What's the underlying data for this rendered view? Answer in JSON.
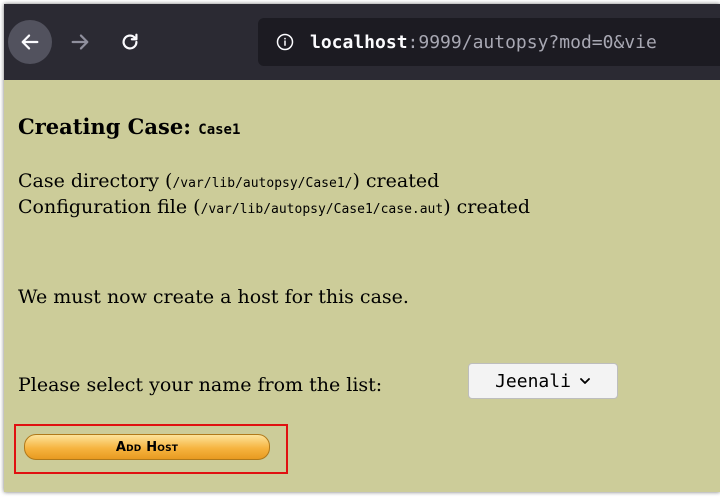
{
  "browser": {
    "url_host": "localhost",
    "url_rest": ":9999/autopsy?mod=0&vie"
  },
  "page": {
    "heading": "Creating Case:",
    "case_name": "Case1",
    "line1_pre": "Case directory (",
    "line1_path": "/var/lib/autopsy/Case1/",
    "line1_post": ") created",
    "line2_pre": "Configuration file (",
    "line2_path": "/var/lib/autopsy/Case1/case.aut",
    "line2_post": ") created",
    "host_message": "We must now create a host for this case.",
    "select_label": "Please select your name from the list:",
    "select_value": "Jeenali",
    "add_host_button": "Add Host"
  },
  "colors": {
    "page_background": "#cccc99",
    "toolbar_background": "#2b2a33",
    "highlight_border": "#e01010",
    "button_gold": "#f6b440"
  },
  "icons": [
    "back-arrow-icon",
    "forward-arrow-icon",
    "reload-icon",
    "info-icon",
    "chevron-down-icon"
  ]
}
